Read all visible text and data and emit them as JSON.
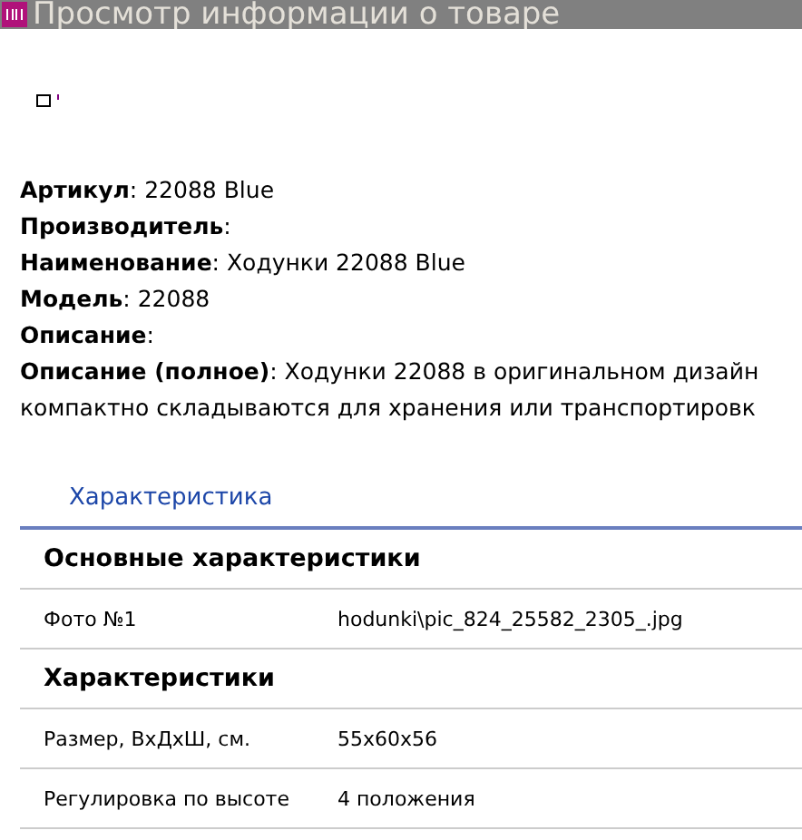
{
  "window": {
    "title": "Просмотр информации о товаре"
  },
  "fields": [
    "**Артикул**: 22088 Blue",
    "**Производитель**:",
    "**Наименование**: Ходунки 22088 Blue",
    "**Модель**: 22088",
    "**Описание**:",
    "**Описание (полное)**: Ходунки 22088 в оригинальном дизайн"
  ],
  "description_continuation": "компактно складываются для хранения или транспортировк",
  "tabs": [
    {
      "label": "Характеристика",
      "selected": true
    }
  ],
  "table": [
    {
      "kind": "section",
      "title": "Основные характеристики"
    },
    {
      "kind": "row",
      "name": "Фото №1",
      "value": "hodunki\\pic_824_25582_2305_.jpg"
    },
    {
      "kind": "section",
      "title": "Характеристики"
    },
    {
      "kind": "row",
      "name": "Размер, ВхДхШ, см.",
      "value": "55x60x56"
    },
    {
      "kind": "row",
      "name": "Регулировка по высоте",
      "value": "4 положения"
    }
  ]
}
